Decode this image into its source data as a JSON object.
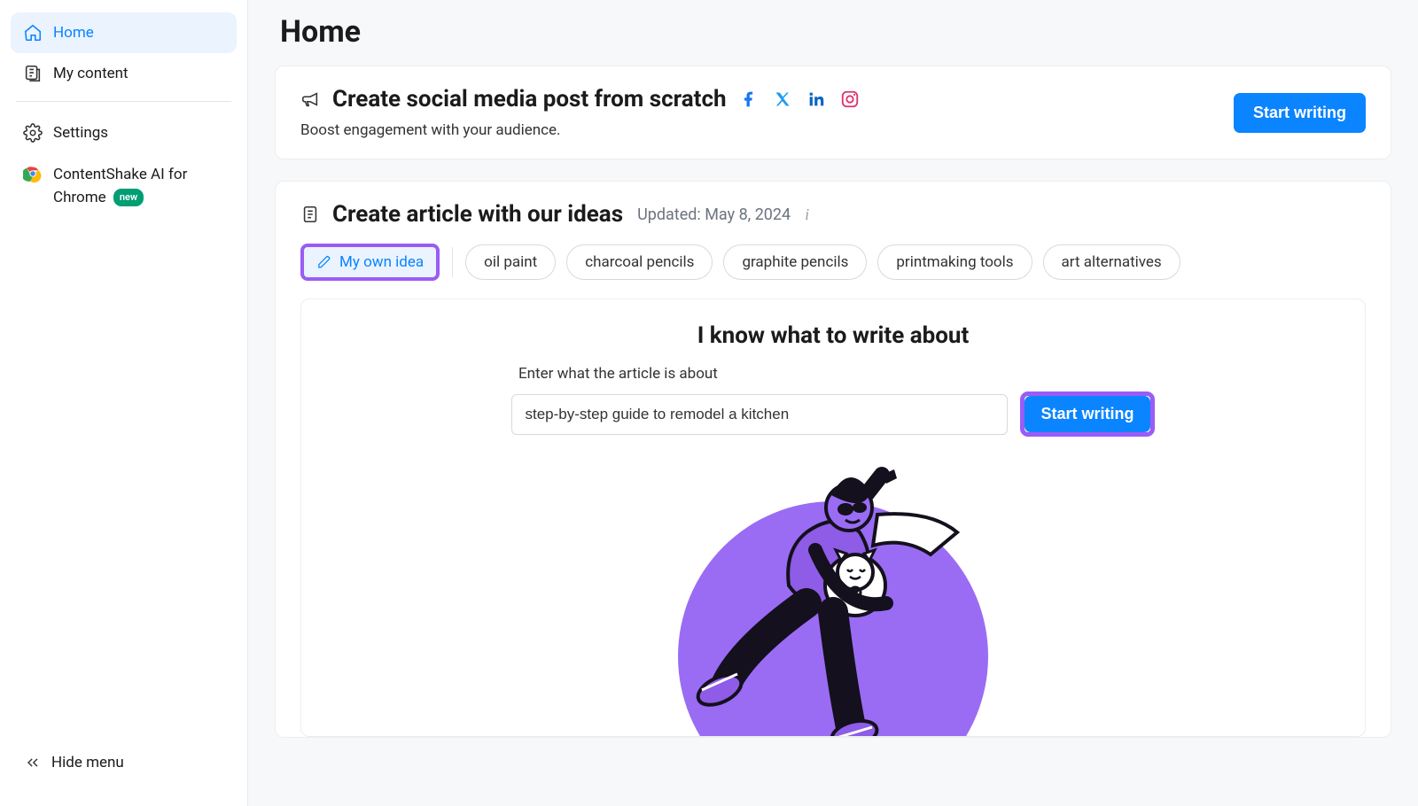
{
  "sidebar": {
    "items": [
      {
        "label": "Home"
      },
      {
        "label": "My content"
      },
      {
        "label": "Settings"
      },
      {
        "label": "ContentShake AI for Chrome",
        "badge": "new"
      }
    ],
    "hide_menu": "Hide menu"
  },
  "page": {
    "title": "Home"
  },
  "social_card": {
    "title": "Create social media post from scratch",
    "subtitle": "Boost engagement with your audience.",
    "button": "Start writing"
  },
  "article_card": {
    "title": "Create article with our ideas",
    "updated": "Updated: May 8, 2024",
    "own_idea_label": "My own idea",
    "chips": [
      "oil paint",
      "charcoal pencils",
      "graphite pencils",
      "printmaking tools",
      "art alternatives"
    ],
    "panel": {
      "heading": "I know what to write about",
      "input_label": "Enter what the article is about",
      "input_value": "step-by-step guide to remodel a kitchen",
      "button": "Start writing"
    }
  }
}
